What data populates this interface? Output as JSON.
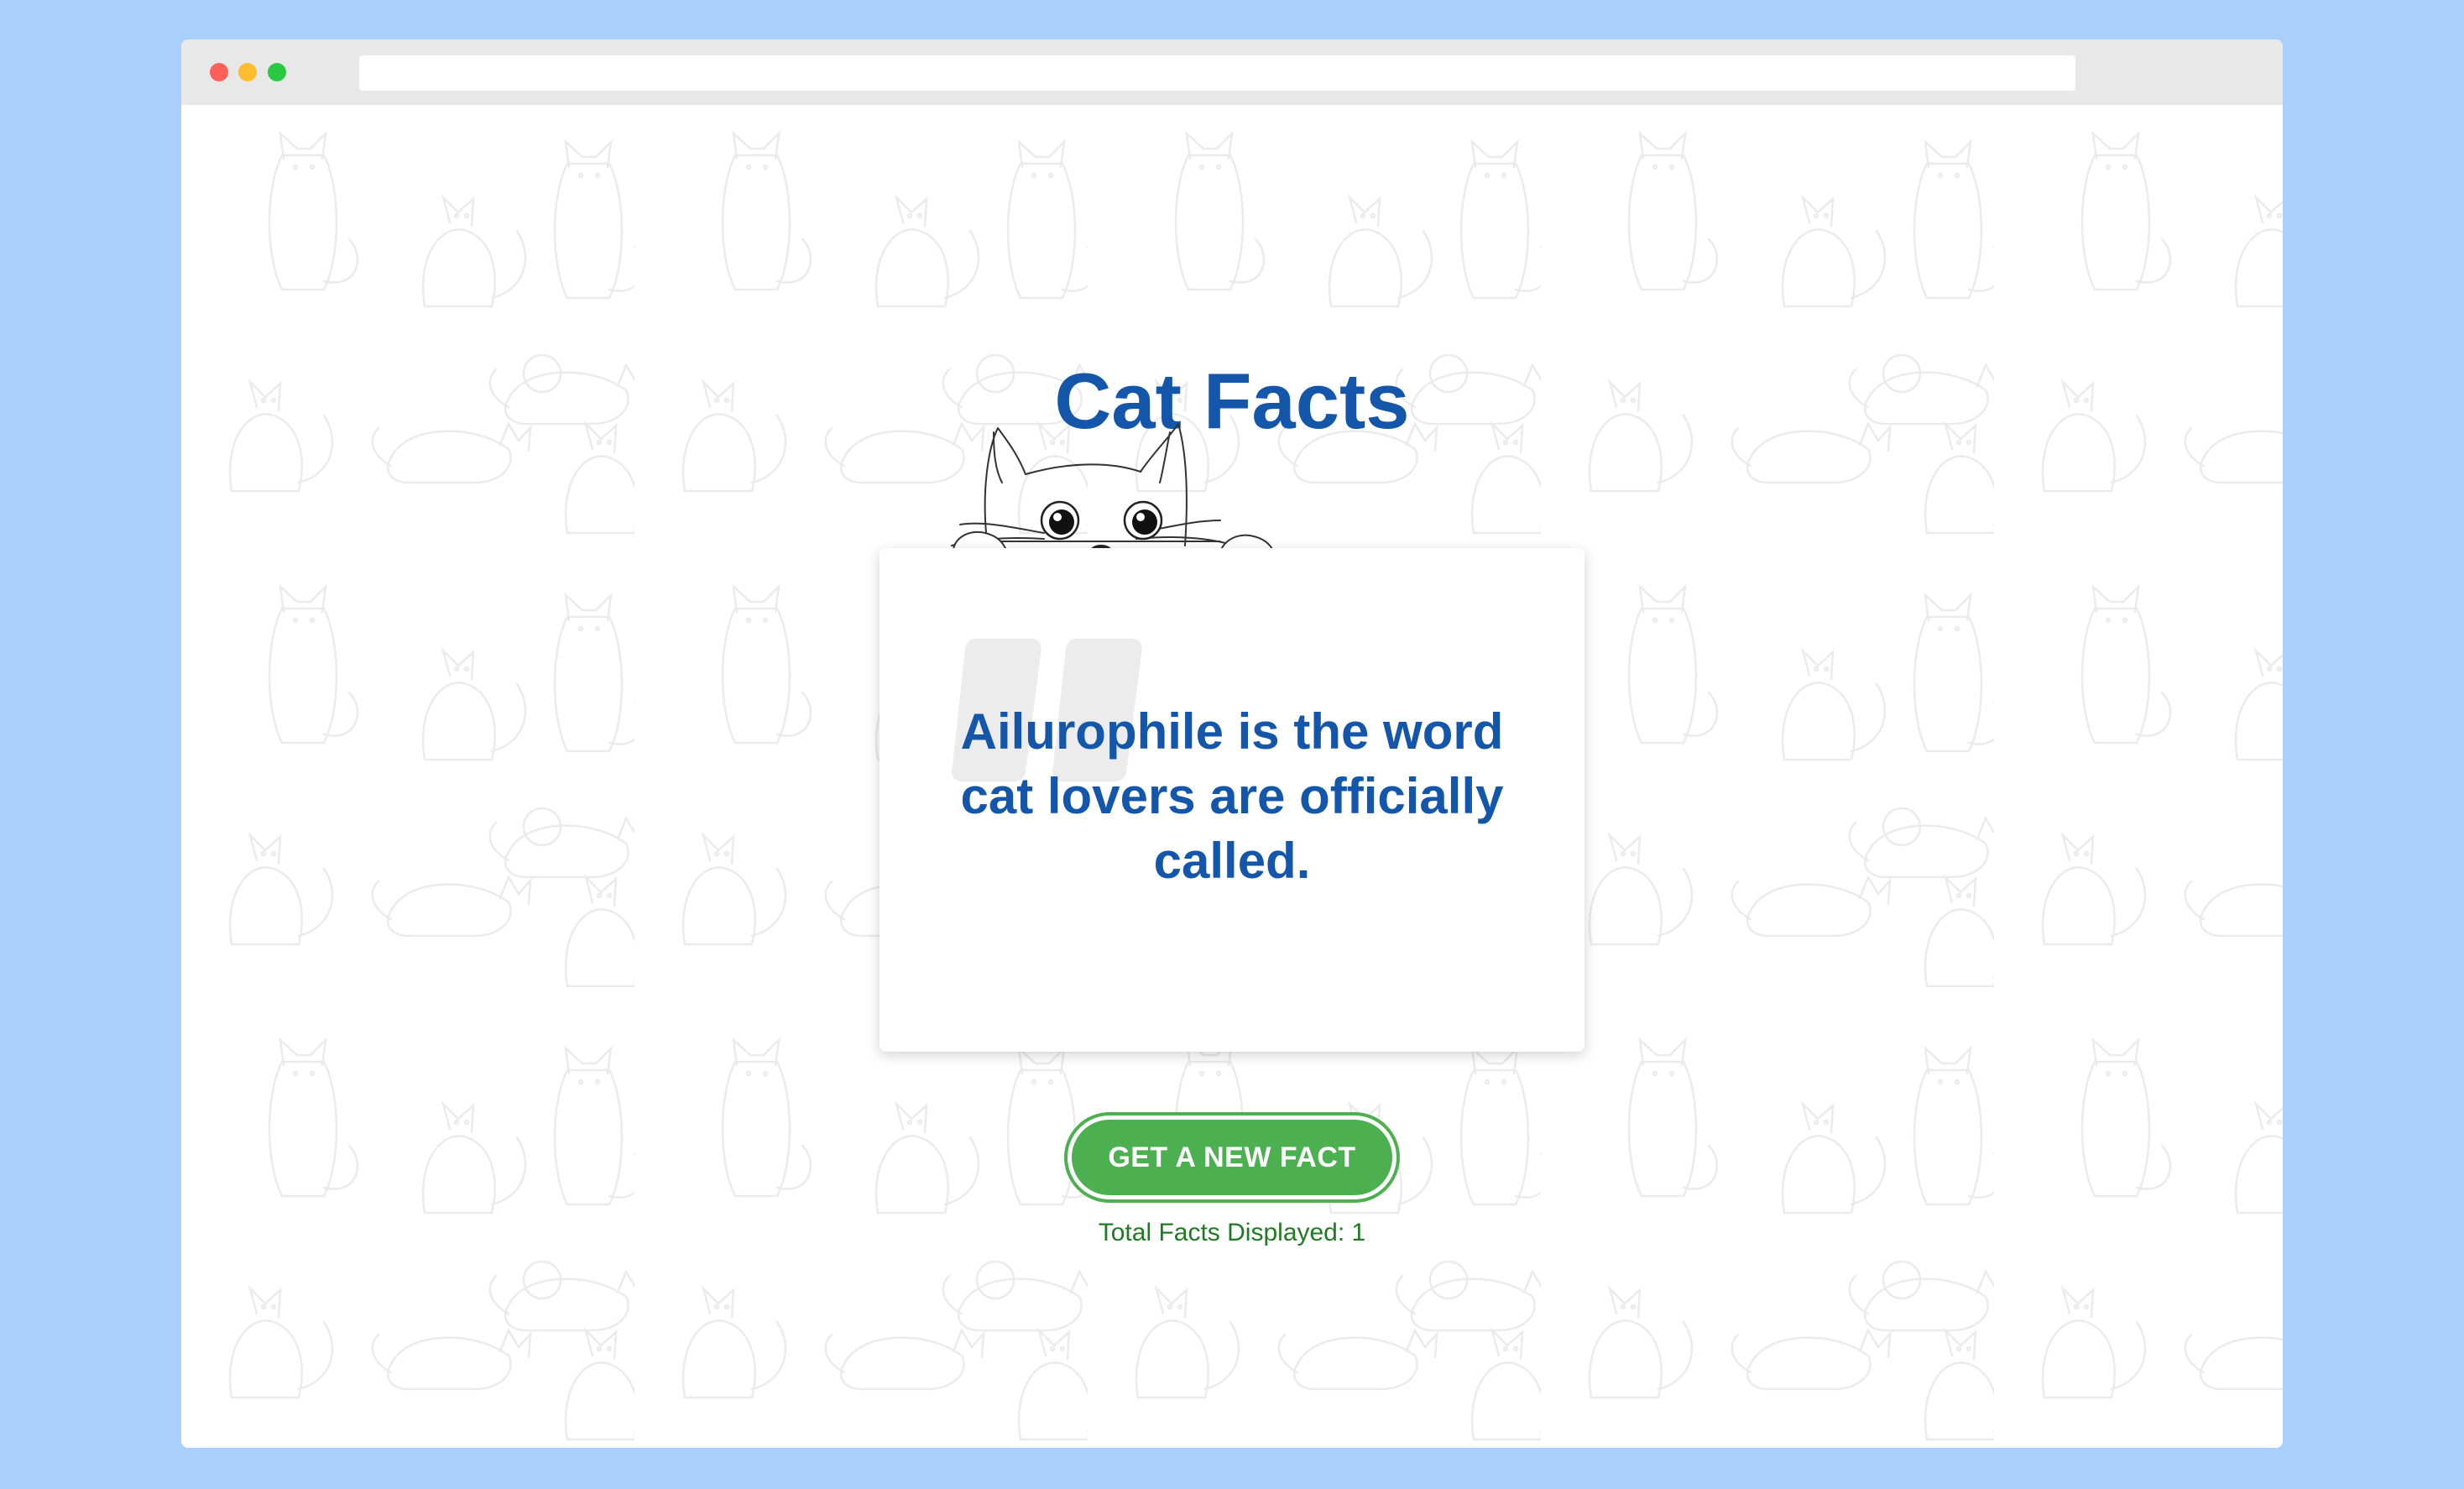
{
  "app": {
    "title": "Cat Facts"
  },
  "fact": {
    "text": "Ailurophile is the word cat lovers are officially called."
  },
  "button": {
    "label": "GET A NEW FACT"
  },
  "counter": {
    "text": "Total Facts Displayed: 1"
  },
  "colors": {
    "page_background": "#a9cffd",
    "title": "#1456aa",
    "button": "#4caf50",
    "counter": "#207a24"
  },
  "icons": {
    "window_controls": [
      "close-icon",
      "minimize-icon",
      "maximize-icon"
    ],
    "mascot": "peeking-cat-icon",
    "quote": "quote-mark-icon"
  }
}
